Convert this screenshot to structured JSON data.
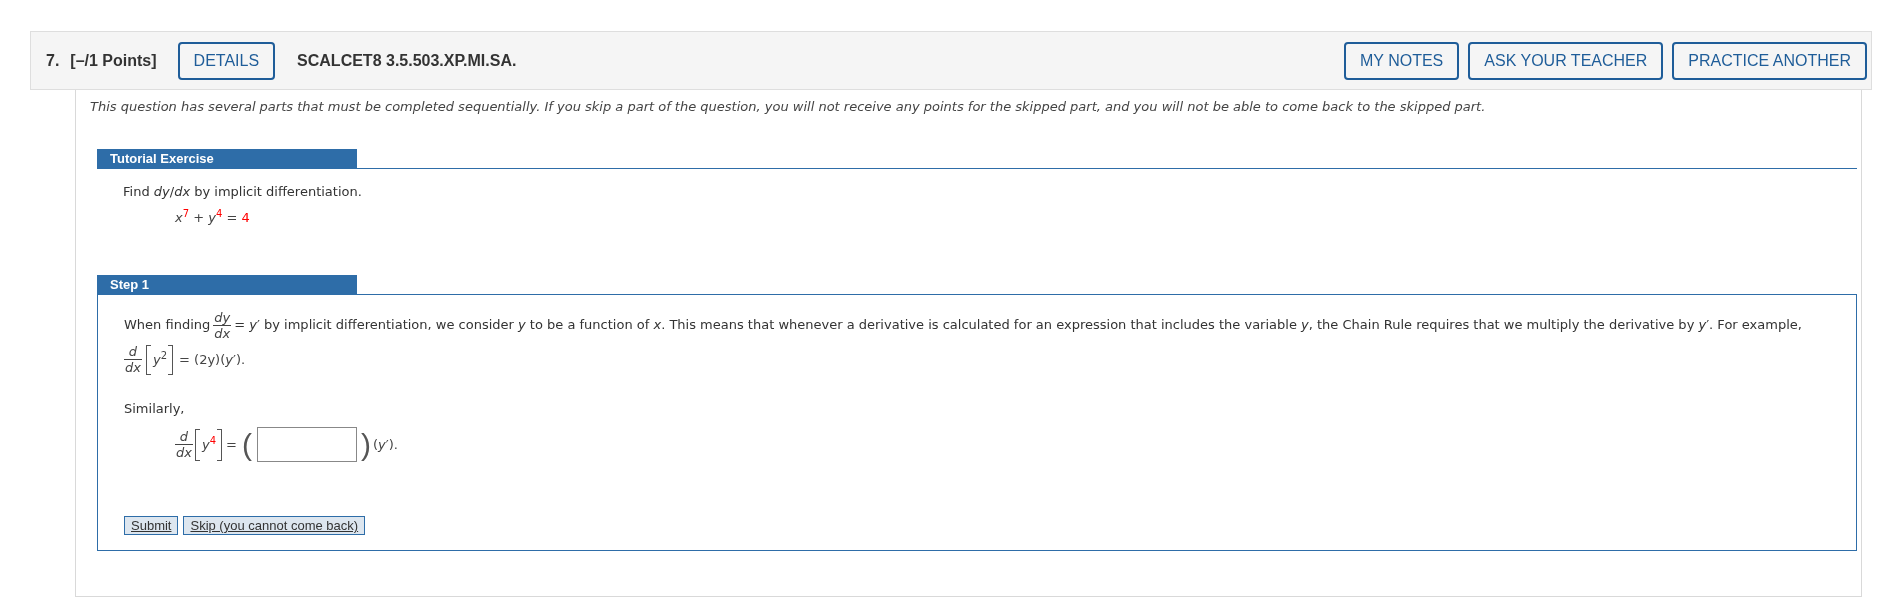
{
  "question": {
    "number": "7.",
    "points": "[–/1 Points]",
    "details_button": "DETAILS",
    "code": "SCALCET8 3.5.503.XP.MI.SA.",
    "buttons": [
      "MY NOTES",
      "ASK YOUR TEACHER",
      "PRACTICE ANOTHER"
    ]
  },
  "notice": "This question has several parts that must be completed sequentially. If you skip a part of the question, you will not receive any points for the skipped part, and you will not be able to come back to the skipped part.",
  "tutorial": {
    "title": "Tutorial Exercise",
    "prompt": "Find *dy*/*dx* by implicit differentiation.",
    "equation": [
      {
        "kind": "term",
        "text": "*x*",
        "highlighted": false
      },
      {
        "kind": "sup",
        "text": "7",
        "highlighted": true
      },
      {
        "kind": "term",
        "text": " + *y*",
        "highlighted": false
      },
      {
        "kind": "sup",
        "text": "4",
        "highlighted": true
      },
      {
        "kind": "term",
        "text": " = ",
        "highlighted": false
      },
      {
        "kind": "term",
        "text": "4",
        "highlighted": true
      }
    ]
  },
  "step": {
    "title": "Step 1",
    "intro": {
      "lead": "When finding",
      "fraction": {
        "numerator": "dy",
        "denominator": "dx"
      },
      "text": "= *y*′ by implicit differentiation, we consider *y* to be a function of *x*. This means that whenever a derivative is calculated for an expression that includes the variable *y*, the Chain Rule requires that we multiply the derivative by *y*′. For example,"
    },
    "example": {
      "operator": {
        "numerator": "d",
        "denominator": "dx"
      },
      "base": "y",
      "exponent": {
        "text": "2",
        "highlighted": false
      },
      "result": "= (2y)(*y*′)."
    },
    "similarly": "Similarly,",
    "exercise": {
      "operator": {
        "numerator": "d",
        "denominator": "dx"
      },
      "base": "y",
      "exponent": {
        "text": "4",
        "highlighted": true
      },
      "equals": "=",
      "open": "(",
      "close": ")",
      "tail": "(*y*′)."
    },
    "buttons": [
      "Submit",
      "Skip (you cannot come back)"
    ]
  }
}
